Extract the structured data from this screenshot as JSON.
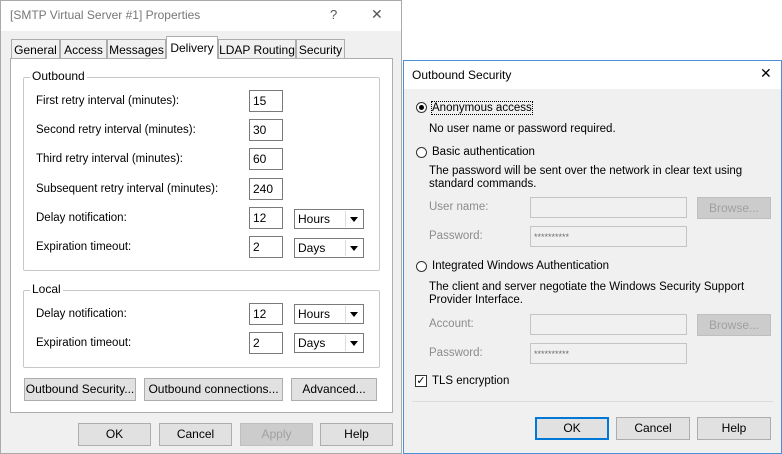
{
  "main_dialog": {
    "title": "[SMTP Virtual Server #1] Properties",
    "help_glyph": "?",
    "close_glyph": "✕",
    "tabs": [
      "General",
      "Access",
      "Messages",
      "Delivery",
      "LDAP Routing",
      "Security"
    ],
    "active_tab": "Delivery",
    "outbound": {
      "label": "Outbound",
      "first_retry_label": "First retry interval (minutes):",
      "first_retry_value": "15",
      "second_retry_label": "Second retry interval (minutes):",
      "second_retry_value": "30",
      "third_retry_label": "Third retry interval (minutes):",
      "third_retry_value": "60",
      "subsequent_retry_label": "Subsequent retry interval (minutes):",
      "subsequent_retry_value": "240",
      "delay_label": "Delay notification:",
      "delay_value": "12",
      "delay_unit": "Hours",
      "expiration_label": "Expiration timeout:",
      "expiration_value": "2",
      "expiration_unit": "Days"
    },
    "local": {
      "label": "Local",
      "delay_label": "Delay notification:",
      "delay_value": "12",
      "delay_unit": "Hours",
      "expiration_label": "Expiration timeout:",
      "expiration_value": "2",
      "expiration_unit": "Days"
    },
    "buttons": {
      "outbound_security": "Outbound Security...",
      "outbound_connections": "Outbound connections...",
      "advanced": "Advanced...",
      "ok": "OK",
      "cancel": "Cancel",
      "apply": "Apply",
      "help": "Help"
    }
  },
  "security_dialog": {
    "title": "Outbound Security",
    "close_glyph": "✕",
    "anonymous": {
      "label": "Anonymous access",
      "desc": "No user name or password required.",
      "selected": true
    },
    "basic": {
      "label": "Basic authentication",
      "desc": "The password will be sent over the network in clear text using standard commands.",
      "username_label": "User name:",
      "username_value": "",
      "password_label": "Password:",
      "password_value": "**********",
      "browse": "Browse..."
    },
    "integrated": {
      "label": "Integrated Windows Authentication",
      "desc": "The client and server negotiate the Windows Security Support Provider Interface.",
      "account_label": "Account:",
      "account_value": "",
      "password_label": "Password:",
      "password_value": "**********",
      "browse": "Browse..."
    },
    "tls": {
      "label": "TLS encryption",
      "checked": true
    },
    "buttons": {
      "ok": "OK",
      "cancel": "Cancel",
      "help": "Help"
    }
  },
  "colors": {
    "accent": "#0078d7",
    "panel_bg": "#f0f0f0",
    "disabled_text": "#8c8c8c"
  }
}
